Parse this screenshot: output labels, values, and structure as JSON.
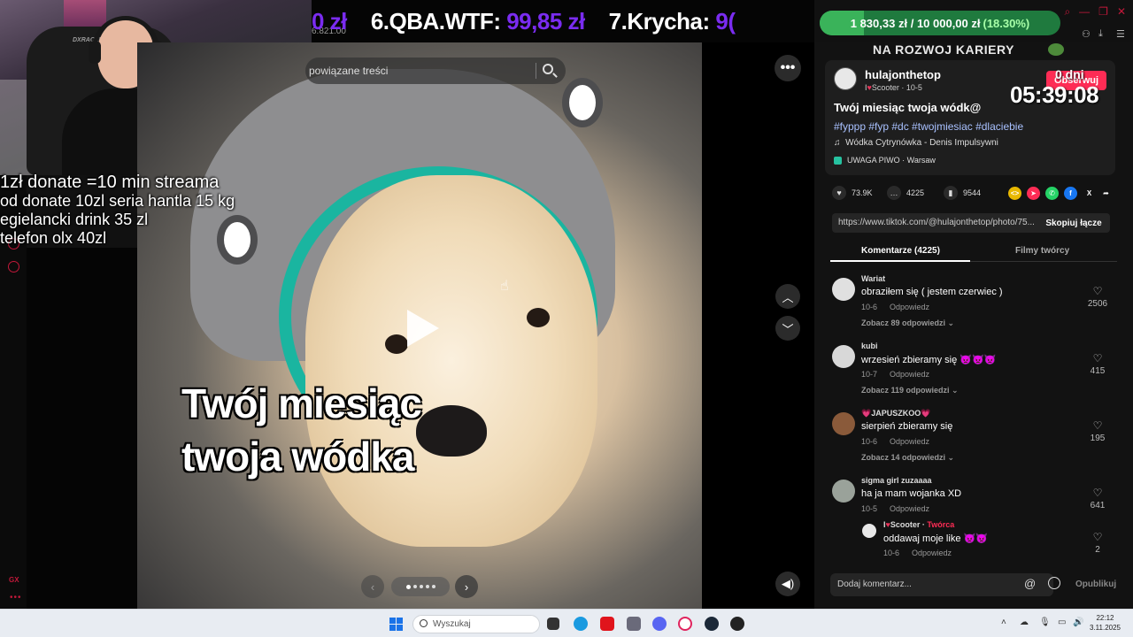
{
  "overlay_lines": [
    "1zł donate =10 min streama",
    "od donate 10zl seria hantla 15 kg",
    "egielancki drink 35 zl",
    "telefon olx 40zl"
  ],
  "webcam": {
    "chair_brand": "DXRACER"
  },
  "ticker": {
    "left_small": "6.821.00",
    "entries": [
      {
        "name": "",
        "amount": "0 zł"
      },
      {
        "name": "6.QBA.WTF:",
        "amount": "99,85 zł"
      },
      {
        "name": "7.Krycha:",
        "amount": "9("
      }
    ]
  },
  "goal": {
    "current": "1 830,33 zł",
    "separator": "/",
    "target": "10 000,00 zł",
    "percent_label": "(18.30%)",
    "progress": 0.183,
    "colors": {
      "track": "#1f7a3e",
      "fill": "#3ab35a"
    }
  },
  "video": {
    "search_placeholder": "powiązane treści",
    "caption_line1": "Twój miesiąc",
    "caption_line2": "twoja wódka",
    "carousel_dots": 5
  },
  "panel": {
    "career_label": "NA ROZWOJ KARIERY",
    "author": {
      "username": "hulajonthetop",
      "subline_prefix": "I",
      "subline_rest": "Scooter · 10-5",
      "follow_label": "Obserwuj"
    },
    "countdown": {
      "days": "0 dni",
      "time": "05:39:08"
    },
    "post_title": "Twój miesiąc twoja wódk@",
    "hashtags": "#fyppp #fyp #dc #twojmiesiac #dlaciebie",
    "music": "Wódka Cytrynówka - Denis Impulsywni",
    "place": "UWAGA PIWO · Warsaw",
    "stats": {
      "likes": "73.9K",
      "comments": "4225",
      "saves": "9544"
    },
    "link": "https://www.tiktok.com/@hulajonthetop/photo/75...",
    "copy_label": "Skopiuj łącze",
    "tabs": [
      "Komentarze (4225)",
      "Filmy twórcy"
    ],
    "comments": [
      {
        "name": "Wariat",
        "text": "obraziłem się ( jestem czerwiec )",
        "date": "10-6",
        "reply": "Odpowiedz",
        "likes": "2506",
        "more": "Zobacz 89 odpowiedzi ⌄",
        "avatar_color": "#e0e0e0"
      },
      {
        "name": "kubi",
        "text": "wrzesień zbieramy się 👿👿👿",
        "date": "10-7",
        "reply": "Odpowiedz",
        "likes": "415",
        "more": "Zobacz 119 odpowiedzi ⌄",
        "avatar_color": "#d8d8d8"
      },
      {
        "name": "💗JAPUSZKOO💗",
        "text": "sierpień zbieramy się",
        "date": "10-6",
        "reply": "Odpowiedz",
        "likes": "195",
        "more": "Zobacz 14 odpowiedzi ⌄",
        "avatar_color": "#8a5a3a"
      },
      {
        "name": "sigma girl zuzaaaa",
        "text": "ha ja mam wojanka XD",
        "date": "10-5",
        "reply": "Odpowiedz",
        "likes": "641",
        "more": "",
        "avatar_color": "#9aa29a"
      }
    ],
    "reply": {
      "name_prefix": "I",
      "name_rest": "Scooter · ",
      "creator": "Twórca",
      "text": "oddawaj moje like 👿👿",
      "date": "10-6",
      "reply": "Odpowiedz",
      "likes": "2"
    },
    "add_comment_placeholder": "Dodaj komentarz...",
    "publish_label": "Opublikuj"
  },
  "taskbar": {
    "search_placeholder": "Wyszukaj",
    "time": "22:12",
    "date": "3.11.2025"
  }
}
